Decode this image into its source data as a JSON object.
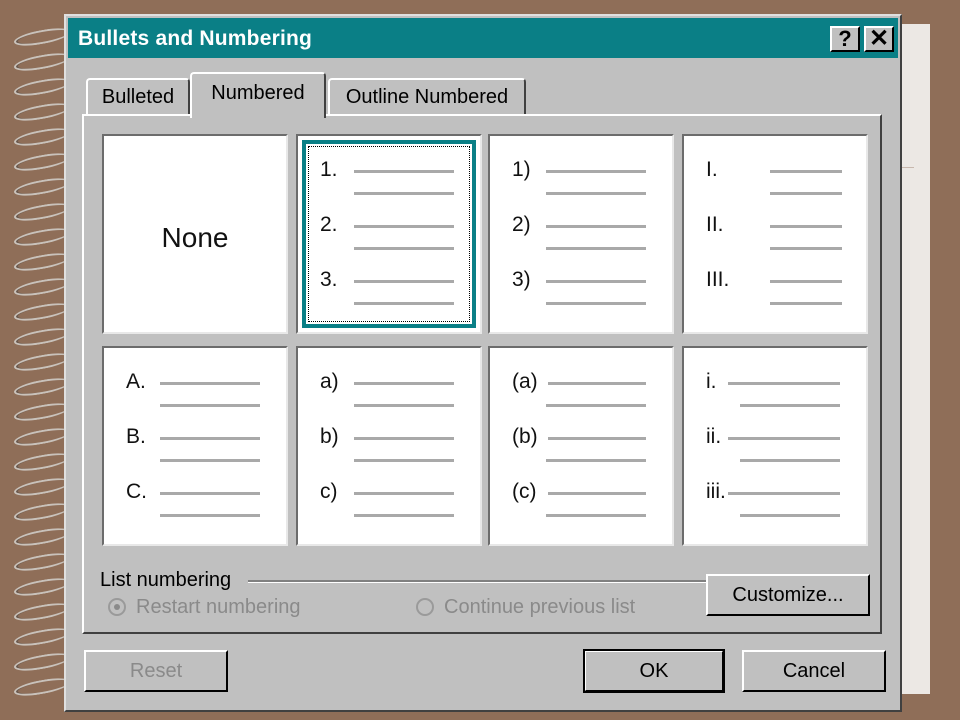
{
  "dialog": {
    "title": "Bullets and Numbering",
    "help_label": "?",
    "close_label": "✕"
  },
  "tabs": [
    {
      "label": "Bulleted",
      "active": false
    },
    {
      "label": "Numbered",
      "active": true
    },
    {
      "label": "Outline Numbered",
      "active": false
    }
  ],
  "styles": {
    "none": {
      "label": "None"
    },
    "s1": [
      "1.",
      "2.",
      "3."
    ],
    "s2": [
      "1)",
      "2)",
      "3)"
    ],
    "s3": [
      "I.",
      "II.",
      "III."
    ],
    "s4": [
      "A.",
      "B.",
      "C."
    ],
    "s5": [
      "a)",
      "b)",
      "c)"
    ],
    "s6": [
      "(a)",
      "(b)",
      "(c)"
    ],
    "s7": [
      "i.",
      "ii.",
      "iii."
    ]
  },
  "list_numbering": {
    "label": "List numbering",
    "restart_label": "Restart numbering",
    "continue_label": "Continue previous list",
    "selected": "restart"
  },
  "buttons": {
    "customize": "Customize...",
    "reset": "Reset",
    "ok": "OK",
    "cancel": "Cancel"
  },
  "colors": {
    "titlebar": "#0a7f86",
    "face": "#c0c0c0",
    "background": "#8f6e58"
  }
}
